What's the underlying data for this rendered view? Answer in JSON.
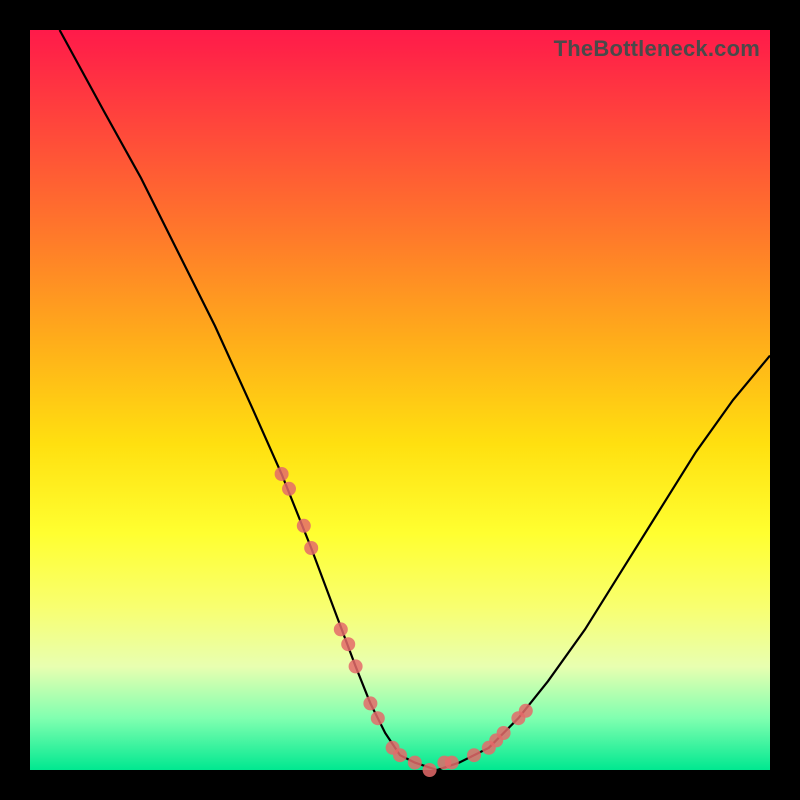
{
  "watermark": "TheBottleneck.com",
  "chart_data": {
    "type": "line",
    "title": "",
    "xlabel": "",
    "ylabel": "",
    "xlim": [
      0,
      100
    ],
    "ylim": [
      0,
      100
    ],
    "series": [
      {
        "name": "curve",
        "x": [
          4,
          10,
          15,
          20,
          25,
          30,
          34,
          38,
          41,
          44,
          46,
          48,
          50,
          52,
          55,
          58,
          62,
          66,
          70,
          75,
          80,
          85,
          90,
          95,
          100
        ],
        "y": [
          100,
          89,
          80,
          70,
          60,
          49,
          40,
          30,
          22,
          14,
          9,
          5,
          2,
          1,
          0,
          1,
          3,
          7,
          12,
          19,
          27,
          35,
          43,
          50,
          56
        ]
      },
      {
        "name": "markers",
        "x": [
          34,
          35,
          37,
          38,
          42,
          43,
          44,
          46,
          47,
          49,
          50,
          52,
          54,
          56,
          57,
          60,
          62,
          63,
          64,
          66,
          67
        ],
        "y": [
          40,
          38,
          33,
          30,
          19,
          17,
          14,
          9,
          7,
          3,
          2,
          1,
          0,
          1,
          1,
          2,
          3,
          4,
          5,
          7,
          8
        ]
      }
    ],
    "colors": {
      "curve": "#000000",
      "marker": "#e46a6a"
    }
  }
}
